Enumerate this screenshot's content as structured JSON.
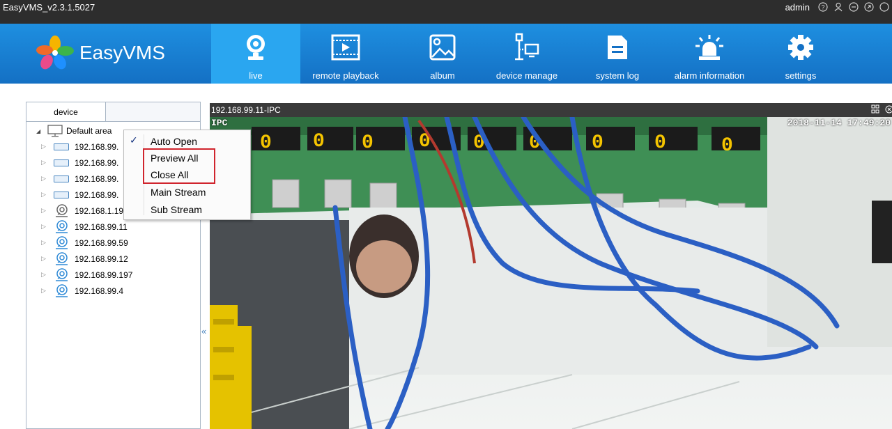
{
  "window": {
    "title": "EasyVMS_v2.3.1.5027",
    "user": "admin"
  },
  "brand": {
    "name": "EasyVMS"
  },
  "nav": [
    {
      "label": "live",
      "icon": "webcam-icon",
      "active": true
    },
    {
      "label": "remote playback",
      "icon": "playback-icon",
      "active": false
    },
    {
      "label": "album",
      "icon": "image-icon",
      "active": false
    },
    {
      "label": "device manage",
      "icon": "device-manage-icon",
      "active": false
    },
    {
      "label": "system log",
      "icon": "document-icon",
      "active": false
    },
    {
      "label": "alarm information",
      "icon": "alarm-light-icon",
      "active": false
    },
    {
      "label": "settings",
      "icon": "gear-icon",
      "active": false
    }
  ],
  "sidebar": {
    "tab": "device",
    "root": "Default area",
    "devices": [
      {
        "name": "192.168.99.",
        "type": "dvr"
      },
      {
        "name": "192.168.99.",
        "type": "dvr"
      },
      {
        "name": "192.168.99.",
        "type": "dvr"
      },
      {
        "name": "192.168.99.",
        "type": "dvr"
      },
      {
        "name": "192.168.1.195",
        "type": "ipc"
      },
      {
        "name": "192.168.99.11",
        "type": "ipc"
      },
      {
        "name": "192.168.99.59",
        "type": "ipc"
      },
      {
        "name": "192.168.99.12",
        "type": "ipc"
      },
      {
        "name": "192.168.99.197",
        "type": "ipc"
      },
      {
        "name": "192.168.99.4",
        "type": "ipc"
      }
    ],
    "collapse": "«"
  },
  "context_menu": {
    "items": [
      {
        "label": "Auto Open",
        "checked": true
      },
      {
        "label": "Preview All",
        "checked": false
      },
      {
        "label": "Close All",
        "checked": false
      },
      {
        "label": "Main Stream",
        "checked": false
      },
      {
        "label": "Sub Stream",
        "checked": false
      }
    ],
    "highlight_color": "#d0242d"
  },
  "video": {
    "camera_name": "192.168.99.11-IPC",
    "osd_channel": "IPC",
    "osd_timestamp": "2018-11-14  17:49:20"
  },
  "colors": {
    "nav_bg": "#1470c4",
    "nav_active": "#2aa6f0",
    "titlebar": "#2d2d2d"
  }
}
